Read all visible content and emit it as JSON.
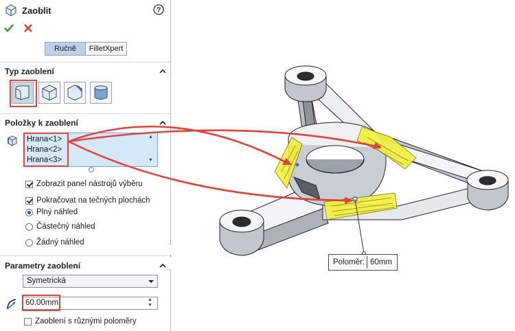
{
  "header": {
    "title": "Zaoblit"
  },
  "tabs": {
    "manual": "Ručně",
    "filletxpert": "FilletXpert"
  },
  "fillet_type": {
    "title": "Typ zaoblení"
  },
  "items": {
    "title": "Položky k zaoblení",
    "list": [
      "Hrana<1>",
      "Hrana<2>",
      "Hrana<3>"
    ]
  },
  "options": {
    "show_toolbar": "Zobrazit panel nástrojů výběru",
    "tangent": "Pokračovat na tečných plochách",
    "preview_full": "Plný náhled",
    "preview_partial": "Částečný náhled",
    "preview_none": "Žádný náhled"
  },
  "params": {
    "title": "Parametry zaoblení",
    "profile": "Symetrická",
    "radius": "60.00mm",
    "multi_radius": "Zaoblení s různými poloměry"
  },
  "callout": {
    "label": "Poloměr:",
    "value": "60mm"
  },
  "colors": {
    "accent_red": "#e0433b",
    "highlight_yellow": "#f3ef3a",
    "selection_blue": "#d4e8f8"
  }
}
